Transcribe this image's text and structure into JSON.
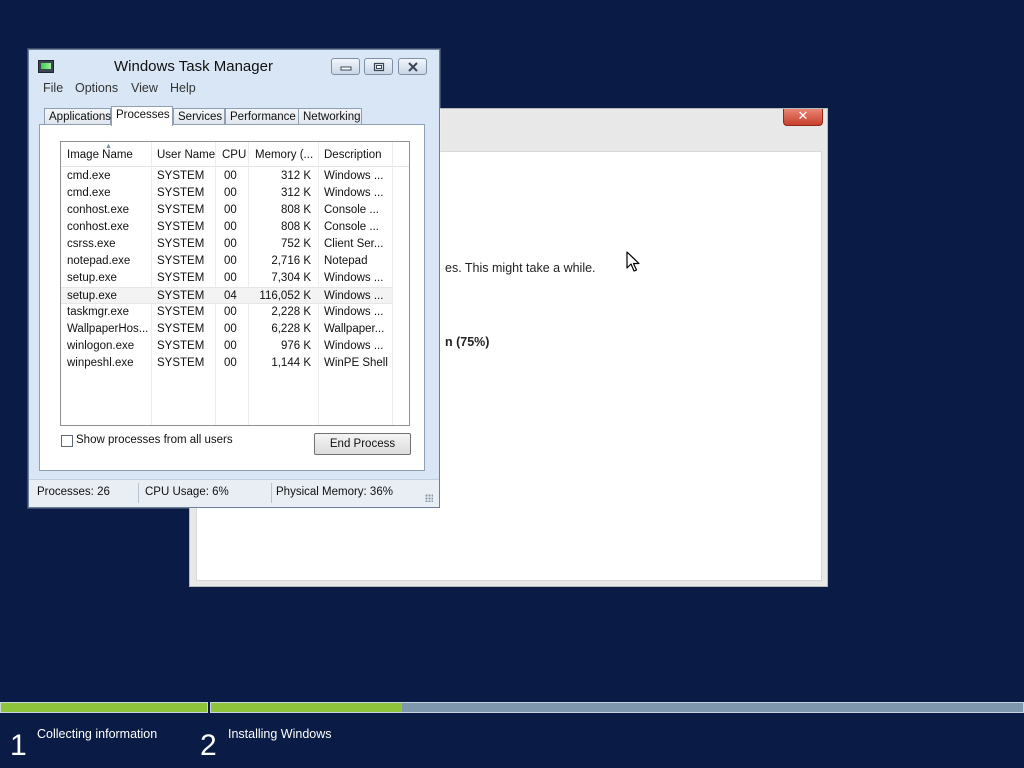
{
  "setup_window": {
    "close_glyph": "✕",
    "message_fragment": "es. This might take a while.",
    "step_fragment": "n (75%)"
  },
  "task_manager": {
    "title": "Windows Task Manager",
    "icon": "task-manager-icon",
    "caption_buttons": {
      "minimize": "▭",
      "maximize": "❐",
      "close": "✕"
    },
    "menu": [
      "File",
      "Options",
      "View",
      "Help"
    ],
    "tabs": [
      "Applications",
      "Processes",
      "Services",
      "Performance",
      "Networking"
    ],
    "active_tab": "Processes",
    "columns": [
      "Image Name",
      "User Name",
      "CPU",
      "Memory (...",
      "Description"
    ],
    "processes": [
      {
        "name": "cmd.exe",
        "user": "SYSTEM",
        "cpu": "00",
        "memory": "312 K",
        "description": "Windows ..."
      },
      {
        "name": "cmd.exe",
        "user": "SYSTEM",
        "cpu": "00",
        "memory": "312 K",
        "description": "Windows ..."
      },
      {
        "name": "conhost.exe",
        "user": "SYSTEM",
        "cpu": "00",
        "memory": "808 K",
        "description": "Console ..."
      },
      {
        "name": "conhost.exe",
        "user": "SYSTEM",
        "cpu": "00",
        "memory": "808 K",
        "description": "Console ..."
      },
      {
        "name": "csrss.exe",
        "user": "SYSTEM",
        "cpu": "00",
        "memory": "752 K",
        "description": "Client Ser..."
      },
      {
        "name": "notepad.exe",
        "user": "SYSTEM",
        "cpu": "00",
        "memory": "2,716 K",
        "description": "Notepad"
      },
      {
        "name": "setup.exe",
        "user": "SYSTEM",
        "cpu": "00",
        "memory": "7,304 K",
        "description": "Windows ..."
      },
      {
        "name": "setup.exe",
        "user": "SYSTEM",
        "cpu": "04",
        "memory": "116,052 K",
        "description": "Windows ..."
      },
      {
        "name": "taskmgr.exe",
        "user": "SYSTEM",
        "cpu": "00",
        "memory": "2,228 K",
        "description": "Windows ..."
      },
      {
        "name": "WallpaperHos...",
        "user": "SYSTEM",
        "cpu": "00",
        "memory": "6,228 K",
        "description": "Wallpaper..."
      },
      {
        "name": "winlogon.exe",
        "user": "SYSTEM",
        "cpu": "00",
        "memory": "976 K",
        "description": "Windows ..."
      },
      {
        "name": "winpeshl.exe",
        "user": "SYSTEM",
        "cpu": "00",
        "memory": "1,144 K",
        "description": "WinPE Shell"
      }
    ],
    "show_all_users_label": "Show processes from all users",
    "show_all_users_checked": false,
    "end_process_label": "End Process",
    "status": {
      "processes": "Processes: 26",
      "cpu_usage": "CPU Usage: 6%",
      "physical_memory": "Physical Memory: 36%"
    }
  },
  "install_progress": {
    "steps": [
      {
        "number": "1",
        "label": "Collecting information",
        "progress": 1.0
      },
      {
        "number": "2",
        "label": "Installing Windows",
        "progress": 0.235
      }
    ],
    "colors": {
      "fill": "#8dc43b",
      "track": "#7e97ad"
    }
  }
}
